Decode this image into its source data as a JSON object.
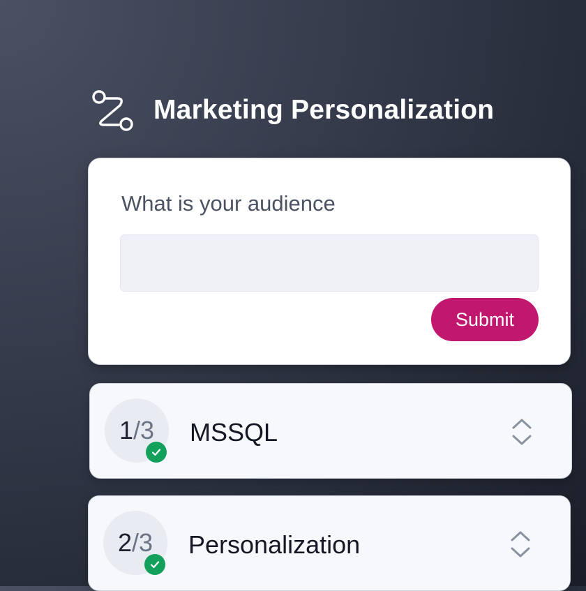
{
  "header": {
    "title": "Marketing Personalization",
    "icon": "route-icon"
  },
  "form": {
    "question": "What is your audience",
    "input_value": "",
    "input_placeholder": "",
    "submit_label": "Submit",
    "submit_color": "#c2176f"
  },
  "steps": [
    {
      "current": "1",
      "separator": "/",
      "total": "3",
      "label": "MSSQL",
      "completed": true
    },
    {
      "current": "2",
      "separator": "/",
      "total": "3",
      "label": "Personalization",
      "completed": true
    }
  ],
  "colors": {
    "check": "#12a05c",
    "badge": "#e8ebf1"
  }
}
